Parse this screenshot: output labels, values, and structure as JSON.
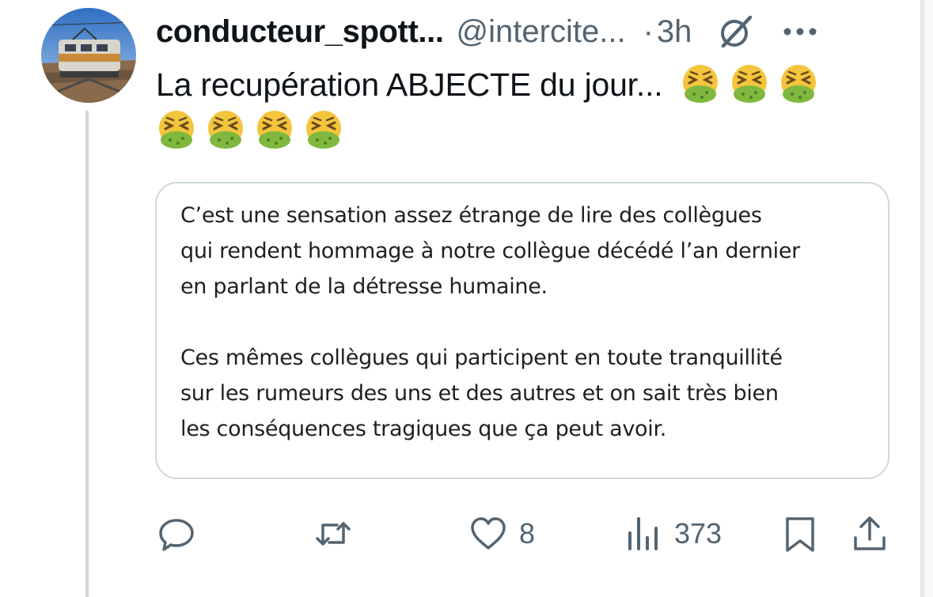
{
  "tweet": {
    "author": {
      "display_name": "conducteur_spott...",
      "handle": "@intercite...",
      "avatar_icon": "train-photo-avatar"
    },
    "separator": "·",
    "time": "3h",
    "text": "La recupération ABJECTE du jour...",
    "emojis": [
      "face-vomiting",
      "face-vomiting",
      "face-vomiting",
      "face-vomiting",
      "face-vomiting",
      "face-vomiting",
      "face-vomiting"
    ],
    "quote": {
      "paragraph_1": "C’est une sensation assez étrange de lire des collègues\nqui rendent hommage à notre collègue décédé l’an dernier\nen parlant de la détresse humaine.",
      "paragraph_2": "Ces mêmes collègues qui participent en toute tranquillité\nsur les rumeurs des uns et des autres et on sait très bien\nles conséquences tragiques que ça peut avoir."
    },
    "actions": {
      "reply_icon": "reply-icon",
      "retweet_icon": "retweet-icon",
      "like_icon": "heart-icon",
      "like_count": "8",
      "views_icon": "views-icon",
      "views_count": "373",
      "bookmark_icon": "bookmark-icon",
      "share_icon": "share-icon"
    }
  },
  "colors": {
    "text_primary": "#0f1419",
    "text_secondary": "#536471",
    "border": "#cfd9de"
  }
}
